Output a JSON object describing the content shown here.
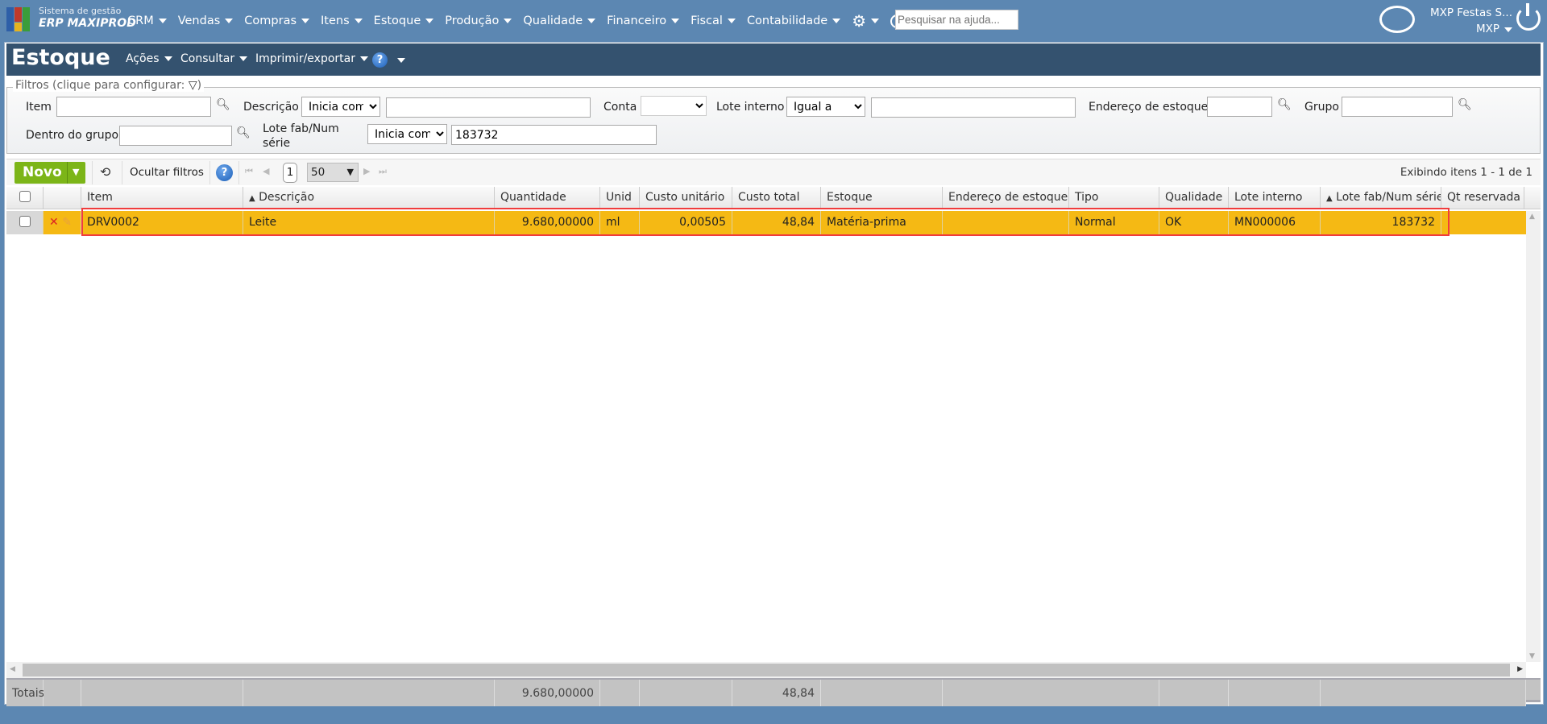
{
  "app": {
    "brand_line1": "Sistema de gestão",
    "brand_line2": "ERP MAXIPROD"
  },
  "menu": [
    "CRM",
    "Vendas",
    "Compras",
    "Itens",
    "Estoque",
    "Produção",
    "Qualidade",
    "Financeiro",
    "Fiscal",
    "Contabilidade"
  ],
  "help_search": {
    "placeholder": "Pesquisar na ajuda..."
  },
  "user": {
    "company": "MXP Festas S...",
    "short": "MXP"
  },
  "page": {
    "title": "Estoque",
    "menus": [
      "Ações",
      "Consultar",
      "Imprimir/exportar"
    ]
  },
  "filters": {
    "legend": "Filtros (clique para configurar:",
    "legend_end": ")",
    "item_label": "Item",
    "item_value": "",
    "descricao_label": "Descrição",
    "descricao_op": "Inicia com",
    "descricao_value": "",
    "conta_label": "Conta",
    "conta_value": "",
    "lote_interno_label": "Lote interno",
    "lote_interno_op": "Igual a",
    "lote_interno_value": "",
    "endereco_label": "Endereço de estoque",
    "endereco_value": "",
    "grupo_label": "Grupo",
    "grupo_value": "",
    "dentro_grupo_label": "Dentro do grupo",
    "dentro_grupo_value": "",
    "lote_fab_label_1": "Lote fab/Num",
    "lote_fab_label_2": "série",
    "lote_fab_op": "Inicia com",
    "lote_fab_value": "183732"
  },
  "toolbar": {
    "novo": "Novo",
    "ocultar": "Ocultar filtros",
    "page": "1",
    "page_size": "50",
    "showing": "Exibindo itens 1 - 1 de 1"
  },
  "columns": [
    "Item",
    "Descrição",
    "Quantidade",
    "Unid",
    "Custo unitário",
    "Custo total",
    "Estoque",
    "Endereço de estoque",
    "Tipo",
    "Qualidade",
    "Lote interno",
    "Lote fab/Num série",
    "Qt reservada"
  ],
  "rows": [
    {
      "item": "DRV0002",
      "descricao": "Leite",
      "quantidade": "9.680,00000",
      "unid": "ml",
      "custo_unitario": "0,00505",
      "custo_total": "48,84",
      "estoque": "Matéria-prima",
      "endereco": "",
      "tipo": "Normal",
      "qualidade": "OK",
      "lote_interno": "MN000006",
      "lote_fab": "183732",
      "qt_reservada": ""
    }
  ],
  "totals": {
    "label": "Totais:",
    "quantidade": "9.680,00000",
    "custo_total": "48,84"
  },
  "colors": {
    "topbar": "#5c87b2",
    "header": "#34526f",
    "row_selected": "#f5b914",
    "novo": "#7cb518",
    "highlight": "#f03c3c"
  }
}
